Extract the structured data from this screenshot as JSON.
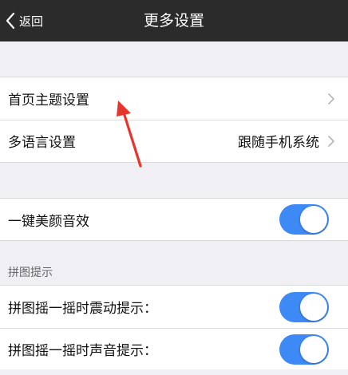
{
  "nav": {
    "back_label": "返回",
    "title": "更多设置"
  },
  "group1": {
    "items": [
      {
        "label": "首页主题设置",
        "value": ""
      },
      {
        "label": "多语言设置",
        "value": "跟随手机系统"
      }
    ]
  },
  "group2": {
    "items": [
      {
        "label": "一键美颜音效",
        "toggle": true
      }
    ]
  },
  "puzzle": {
    "header": "拼图提示",
    "items": [
      {
        "label": "拼图摇一摇时震动提示：",
        "toggle": true
      },
      {
        "label": "拼图摇一摇时声音提示：",
        "toggle": true
      }
    ]
  },
  "colors": {
    "nav_bg": "#2b2b2b",
    "toggle_on": "#3d8af7",
    "annotation_arrow": "#e8352b",
    "page_bg": "#efeff4"
  },
  "icons": {
    "back": "chevron-left-icon",
    "disclosure": "chevron-right-icon"
  }
}
